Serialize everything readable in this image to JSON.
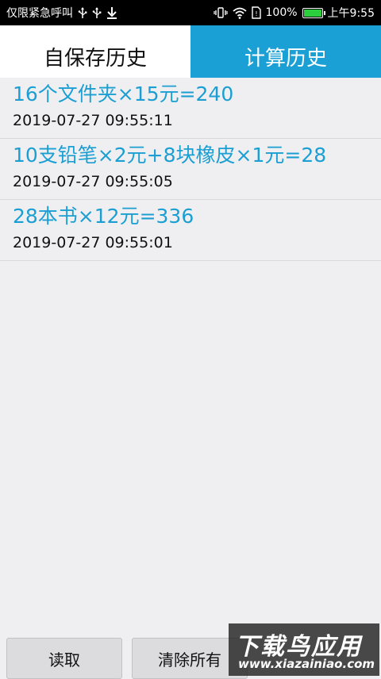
{
  "status_bar": {
    "carrier_text": "仅限紧急呼叫",
    "battery_text": "100%",
    "time": "上午9:55",
    "battery_level": 1.0,
    "battery_color": "#2bcf3e",
    "icons": [
      "usb-icon",
      "usb-icon",
      "download-icon",
      "vibrate-icon",
      "wifi-icon",
      "sim-icon",
      "battery-icon"
    ]
  },
  "tabs": [
    {
      "label": "自保存历史",
      "active": false
    },
    {
      "label": "计算历史",
      "active": true
    }
  ],
  "history": [
    {
      "expression": "16个文件夹×15元=240",
      "time": "2019-07-27 09:55:11"
    },
    {
      "expression": "10支铅笔×2元+8块橡皮×1元=28",
      "time": "2019-07-27 09:55:05"
    },
    {
      "expression": "28本书×12元=336",
      "time": "2019-07-27 09:55:01"
    }
  ],
  "buttons": {
    "read_label": "读取",
    "clear_label": "清除所有"
  },
  "watermark": {
    "title": "下载鸟应用",
    "url": "www.xiazainiao.com"
  },
  "colors": {
    "accent": "#1ba0d6",
    "expression_text": "#1b9fd3",
    "background": "#efeff1"
  }
}
